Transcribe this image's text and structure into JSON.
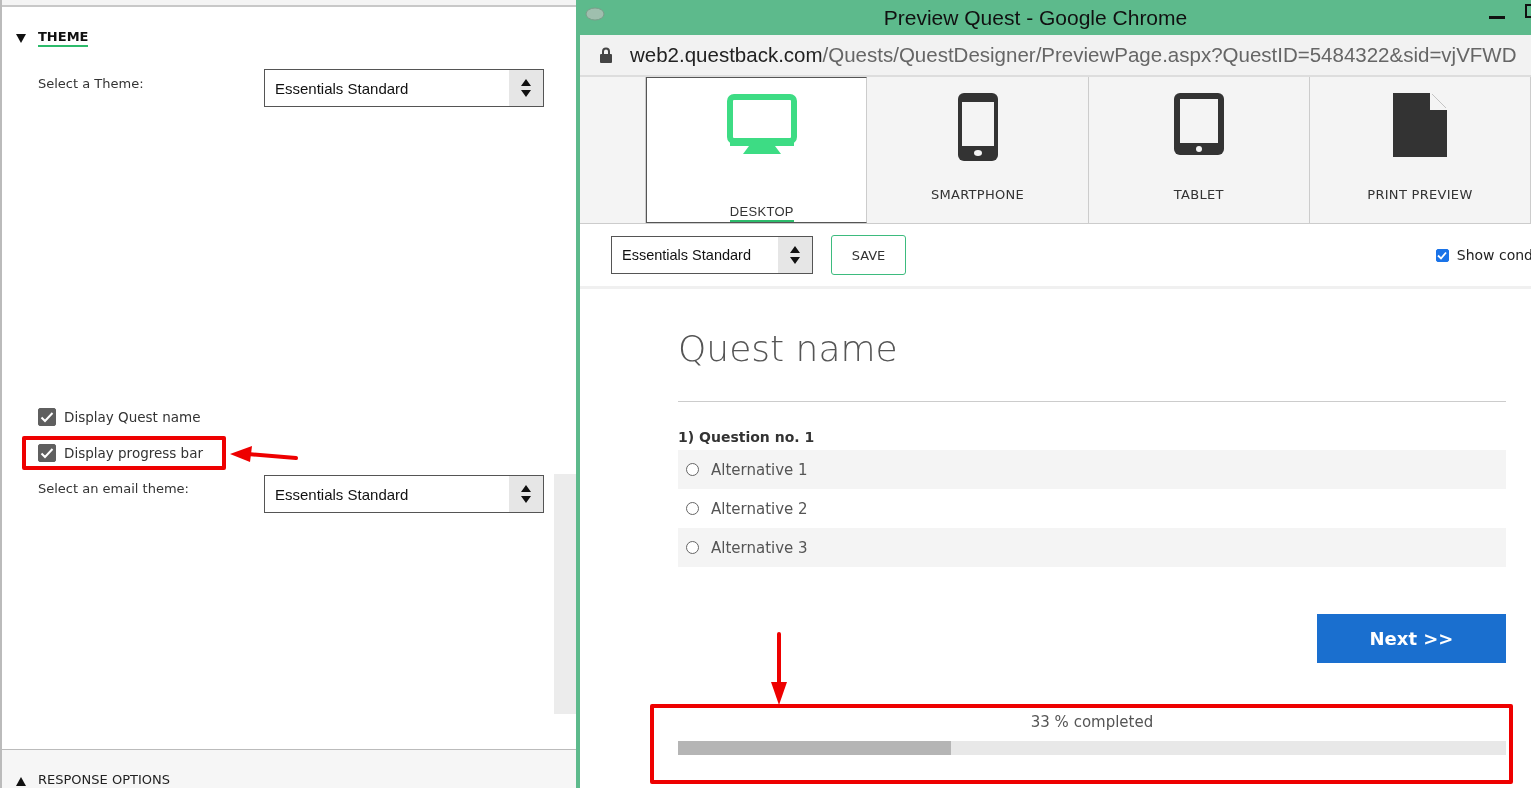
{
  "settings": {
    "theme_section": {
      "title": "THEME",
      "expanded": true
    },
    "theme_select": {
      "label": "Select a Theme:",
      "value": "Essentials Standard"
    },
    "options": [
      {
        "label": "Display Quest name",
        "checked": true
      },
      {
        "label": "Display progress bar",
        "checked": true
      }
    ],
    "email_select": {
      "label": "Select an email theme:",
      "value": "Essentials Standard"
    },
    "response_section": {
      "title": "RESPONSE OPTIONS",
      "expanded": false
    }
  },
  "browser": {
    "title": "Preview Quest - Google Chrome",
    "url_host": "web2.questback.com",
    "url_path": "/Quests/QuestDesigner/PreviewPage.aspx?QuestID=5484322&sid=vjVFWD"
  },
  "tabs": [
    {
      "label": "DESKTOP",
      "kind": "desktop",
      "selected": true
    },
    {
      "label": "SMARTPHONE",
      "kind": "phone",
      "selected": false
    },
    {
      "label": "TABLET",
      "kind": "tablet",
      "selected": false
    },
    {
      "label": "PRINT PREVIEW",
      "kind": "document",
      "selected": false
    }
  ],
  "toolbar": {
    "theme_value": "Essentials Standard",
    "save": "SAVE",
    "show_label": "Show cond",
    "show_checked": true
  },
  "survey": {
    "title": "Quest name",
    "question": "1) Question no. 1",
    "alternatives": [
      {
        "label": "Alternative 1",
        "selected": false
      },
      {
        "label": "Alternative 2",
        "selected": false
      },
      {
        "label": "Alternative 3",
        "selected": false
      }
    ],
    "next": "Next >>",
    "progress_text": "33 % completed",
    "level": 0.33
  }
}
